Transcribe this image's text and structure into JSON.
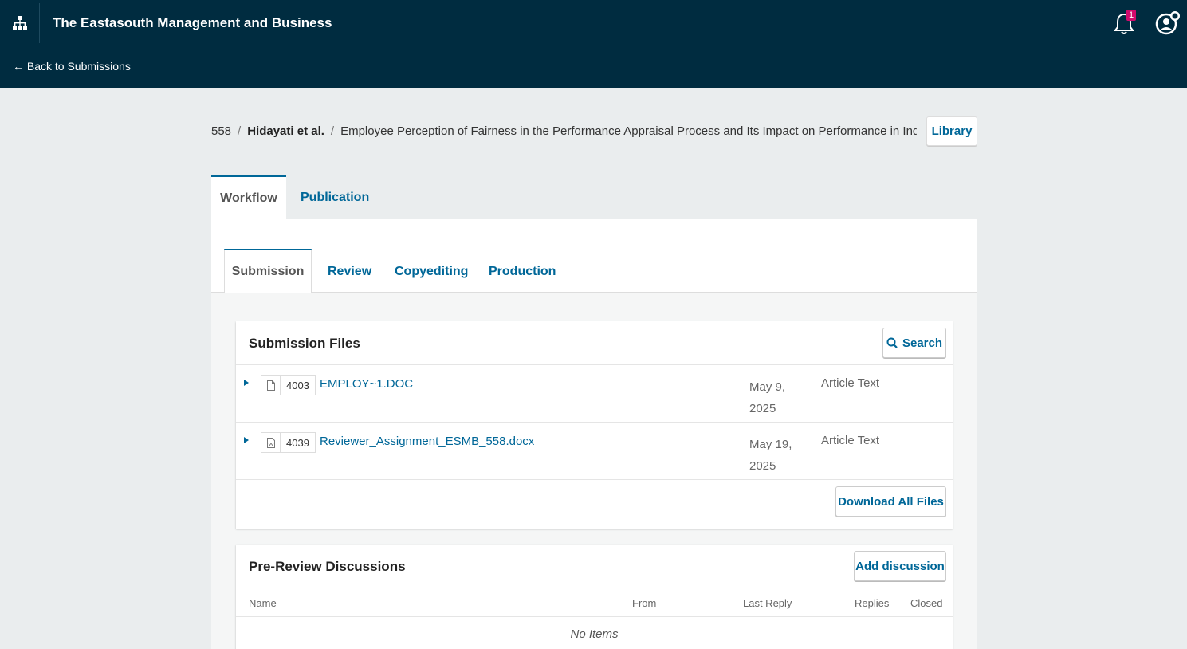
{
  "header": {
    "site_title": "The Eastasouth Management and Business",
    "back_link": "← Back to Submissions",
    "notification_count": "1"
  },
  "breadcrumb": {
    "id": "558",
    "authors": "Hidayati et al.",
    "title": "Employee Perception of Fairness in the Performance Appraisal Process and Its Impact on Performance in Indonesia"
  },
  "library_button": "Library",
  "top_tabs": [
    {
      "label": "Workflow",
      "active": true
    },
    {
      "label": "Publication",
      "active": false
    }
  ],
  "stage_tabs": [
    {
      "label": "Submission",
      "active": true
    },
    {
      "label": "Review",
      "active": false
    },
    {
      "label": "Copyediting",
      "active": false
    },
    {
      "label": "Production",
      "active": false
    }
  ],
  "submission_files": {
    "title": "Submission Files",
    "search_label": "Search",
    "files": [
      {
        "id": "4003",
        "name": "EMPLOY~1.DOC",
        "date_line1": "May 9,",
        "date_line2": "2025",
        "type": "Article Text",
        "icon": "file-icon"
      },
      {
        "id": "4039",
        "name": "Reviewer_Assignment_ESMB_558.docx",
        "date_line1": "May 19,",
        "date_line2": "2025",
        "type": "Article Text",
        "icon": "word-file-icon"
      }
    ],
    "download_all_label": "Download All Files"
  },
  "pre_review": {
    "title": "Pre-Review Discussions",
    "add_label": "Add discussion",
    "columns": {
      "name": "Name",
      "from": "From",
      "last_reply": "Last Reply",
      "replies": "Replies",
      "closed": "Closed"
    },
    "empty_text": "No Items"
  },
  "colors": {
    "header_bg": "#002c40",
    "accent": "#006798",
    "badge": "#d00a6c",
    "page_bg": "#eaedee"
  }
}
